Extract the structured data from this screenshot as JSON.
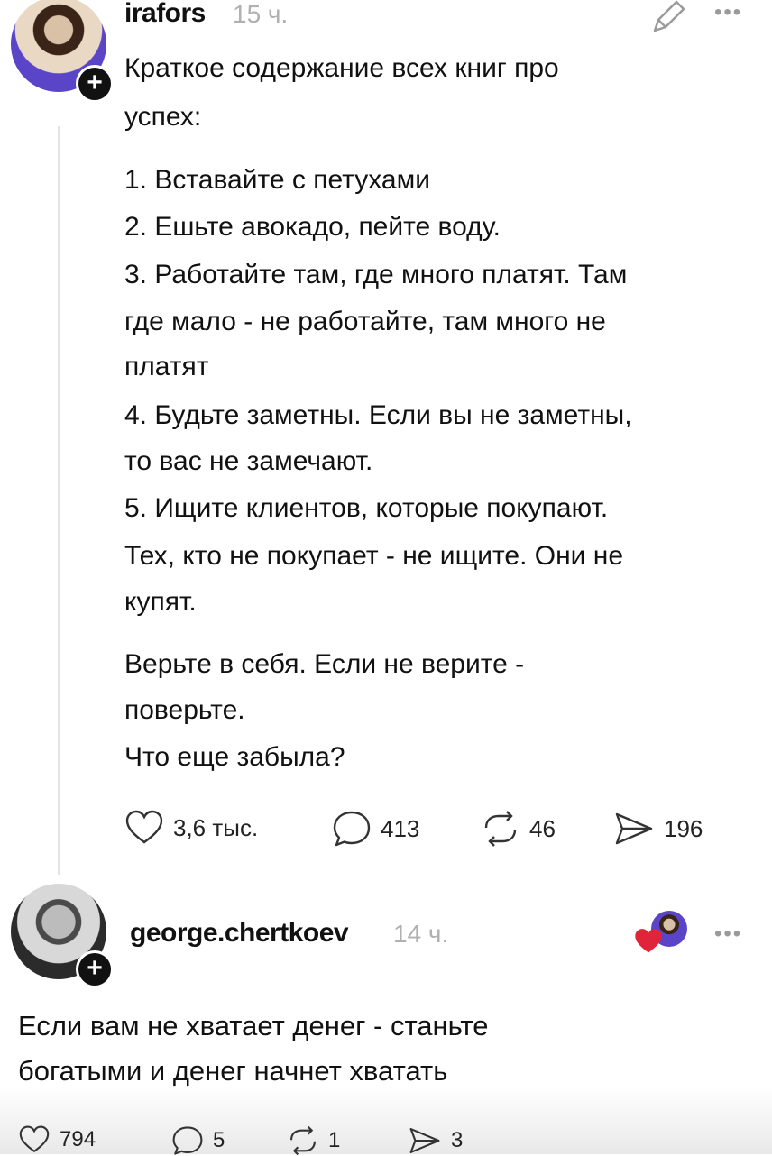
{
  "post": {
    "username": "irafors",
    "time": "15 ч.",
    "lines": [
      "Краткое содержание всех книг про",
      "успех:",
      "1. Вставайте с петухами",
      "2. Ешьте авокадо, пейте воду.",
      "3. Работайте там, где много платят. Там",
      "где мало - не работайте, там много не",
      "платят",
      "4. Будьте заметны. Если вы не заметны,",
      "то вас не замечают.",
      "5. Ищите клиентов, которые покупают.",
      "Тех, кто не покупает - не ищите. Они не",
      "купят.",
      "Верьте в себя. Если не верите -",
      "поверьте.",
      "Что еще забыла?"
    ],
    "actions": {
      "likes": "3,6 тыс.",
      "comments": "413",
      "reposts": "46",
      "shares": "196"
    }
  },
  "reply": {
    "username": "george.chertkoev",
    "time": "14 ч.",
    "lines": [
      "Если вам не хватает денег - станьте",
      "богатыми и денег начнет хватать"
    ],
    "actions": {
      "likes": "794",
      "comments": "5",
      "reposts": "1",
      "shares": "3"
    }
  },
  "icons": {
    "more": "ellipsis-icon",
    "edit": "pencil-icon",
    "like": "heart-icon",
    "comment": "speech-bubble-icon",
    "repost": "repost-icon",
    "share": "send-icon",
    "follow": "plus-icon"
  },
  "colors": {
    "text": "#111111",
    "muted": "#b0b0b0",
    "heart_red": "#e0243a"
  }
}
